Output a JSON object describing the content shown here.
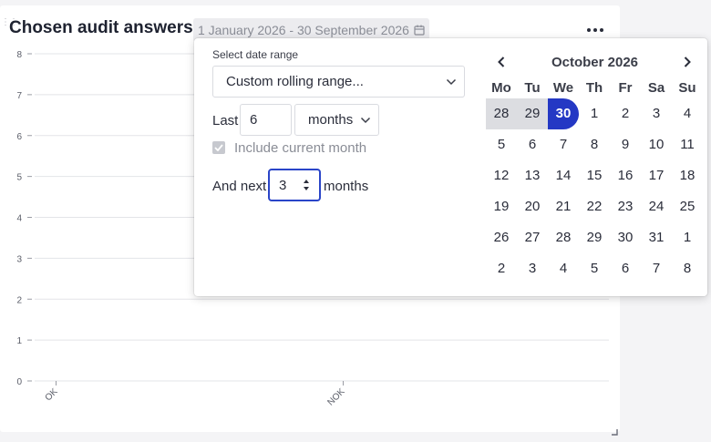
{
  "widget": {
    "title": "Chosen audit answers",
    "date_range": "1 January 2026 - 30 September 2026"
  },
  "chart_data": {
    "type": "bar",
    "categories": [
      "OK",
      "NOK"
    ],
    "values": [
      0,
      0
    ],
    "ylim": [
      0,
      8
    ],
    "yticks": [
      "0",
      "1",
      "2",
      "3",
      "4",
      "5",
      "6",
      "7",
      "8"
    ],
    "grid": true
  },
  "picker": {
    "section_label": "Select date range",
    "range_mode": "Custom rolling range...",
    "last_label": "Last",
    "last_value": "6",
    "last_unit": "months",
    "include_current_label": "Include current month",
    "include_current_checked": true,
    "next_label": "And next",
    "next_value": "3",
    "next_unit_label": "months"
  },
  "calendar": {
    "month_label": "October 2026",
    "weekdays": [
      "Mo",
      "Tu",
      "We",
      "Th",
      "Fr",
      "Sa",
      "Su"
    ],
    "weeks": [
      [
        "28",
        "29",
        "30",
        "1",
        "2",
        "3",
        "4"
      ],
      [
        "5",
        "6",
        "7",
        "8",
        "9",
        "10",
        "11"
      ],
      [
        "12",
        "13",
        "14",
        "15",
        "16",
        "17",
        "18"
      ],
      [
        "19",
        "20",
        "21",
        "22",
        "23",
        "24",
        "25"
      ],
      [
        "26",
        "27",
        "28",
        "29",
        "30",
        "31",
        "1"
      ],
      [
        "2",
        "3",
        "4",
        "5",
        "6",
        "7",
        "8"
      ]
    ],
    "selected_day": "30",
    "range_days": [
      "28",
      "29"
    ]
  },
  "icons": {
    "calendar": "calendar-icon",
    "more": "more-dots-icon",
    "prev": "chevron-left-icon",
    "next": "chevron-right-icon",
    "dropdown": "chevron-down-icon"
  },
  "colors": {
    "accent": "#2438c4",
    "focus_border": "#2a45c8"
  }
}
